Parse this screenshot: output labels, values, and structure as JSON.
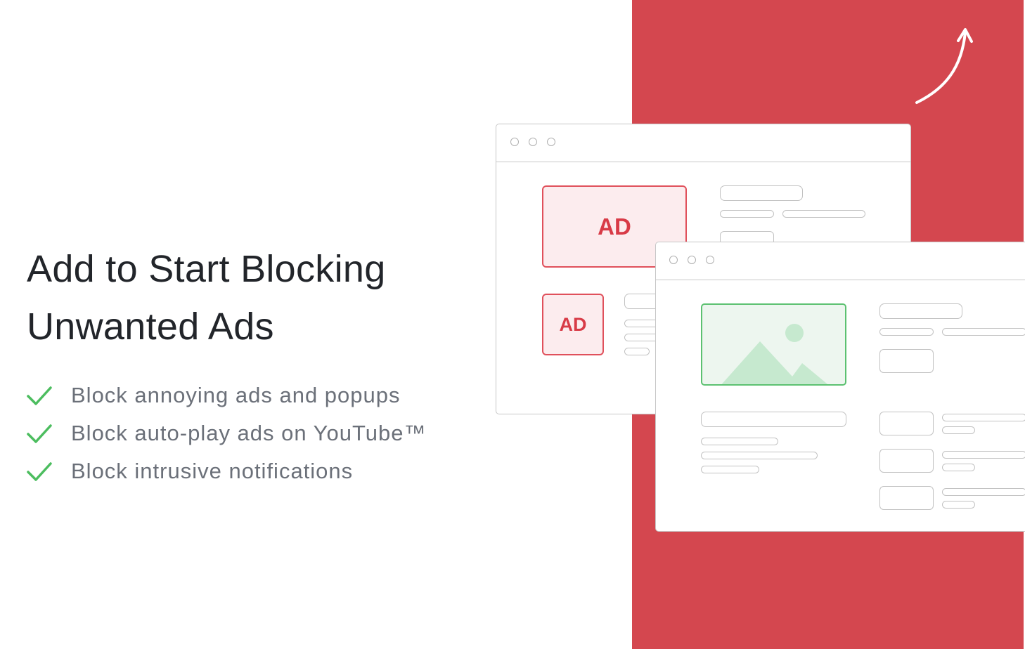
{
  "headline": {
    "line1": "Add to Start Blocking",
    "line2": "Unwanted Ads"
  },
  "features": [
    {
      "icon": "check-icon",
      "text": "Block annoying ads and popups"
    },
    {
      "icon": "check-icon",
      "text": "Block auto-play ads on YouTube™"
    },
    {
      "icon": "check-icon",
      "text": "Block intrusive notifications"
    }
  ],
  "illustration": {
    "ad_label_large": "AD",
    "ad_label_small": "AD"
  },
  "colors": {
    "panel_red": "#d4474f",
    "check_green": "#4cbd5f",
    "ad_red": "#d83b47",
    "image_green": "#5cc171"
  }
}
